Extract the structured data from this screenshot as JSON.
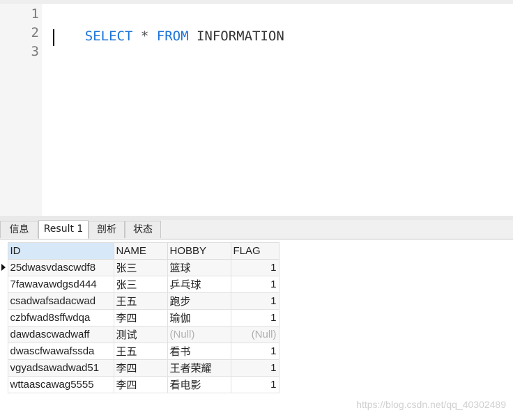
{
  "editor": {
    "line_numbers": [
      "1",
      "2",
      "3"
    ],
    "code": {
      "kw1": "SELECT",
      "op": "*",
      "kw2": "FROM",
      "table": "INFORMATION"
    }
  },
  "tabs": [
    {
      "label": "信息",
      "active": false
    },
    {
      "label": "Result 1",
      "active": true
    },
    {
      "label": "剖析",
      "active": false
    },
    {
      "label": "状态",
      "active": false
    }
  ],
  "grid": {
    "columns": [
      "ID",
      "NAME",
      "HOBBY",
      "FLAG"
    ],
    "rows": [
      {
        "id": "25dwasvdascwdf8",
        "name": "张三",
        "hobby": "篮球",
        "flag": "1",
        "current": true
      },
      {
        "id": "7fawavawdgsd444",
        "name": "张三",
        "hobby": "乒乓球",
        "flag": "1"
      },
      {
        "id": "csadwafsadacwad",
        "name": "王五",
        "hobby": "跑步",
        "flag": "1"
      },
      {
        "id": "czbfwad8sffwdqa",
        "name": "李四",
        "hobby": "瑜伽",
        "flag": "1"
      },
      {
        "id": "dawdascwadwaff",
        "name": "测试",
        "hobby": "(Null)",
        "flag": "(Null)",
        "null": true
      },
      {
        "id": "dwascfwawafssda",
        "name": "王五",
        "hobby": "看书",
        "flag": "1"
      },
      {
        "id": "vgyadsawadwad51",
        "name": "李四",
        "hobby": "王者荣耀",
        "flag": "1"
      },
      {
        "id": "wttaascawag5555",
        "name": "李四",
        "hobby": "看电影",
        "flag": "1"
      }
    ]
  },
  "watermark": "https://blog.csdn.net/qq_40302489"
}
